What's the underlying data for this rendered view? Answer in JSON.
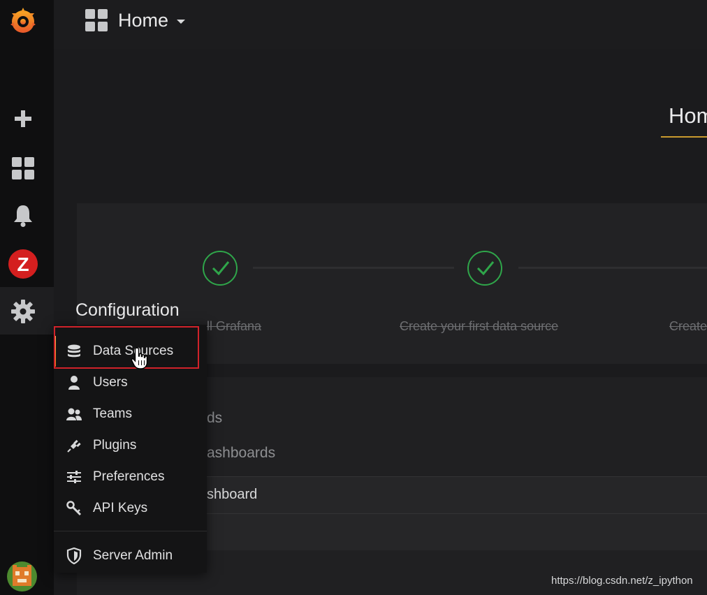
{
  "header": {
    "dashboard_title": "Home"
  },
  "sidebar": {
    "icons": [
      "grafana-logo-icon",
      "plus-icon",
      "apps-icon",
      "bell-icon",
      "zabbix-icon",
      "gear-icon",
      "avatar"
    ],
    "zabbix_letter": "Z"
  },
  "main": {
    "home_heading": "Hom",
    "steps": [
      {
        "label": "Install Grafana",
        "visible_text": "ll Grafana",
        "done": true
      },
      {
        "label": "Create your first data source",
        "visible_text": "Create your first data source",
        "done": true
      },
      {
        "label": "Create",
        "visible_text": "Create",
        "done": false
      }
    ],
    "list_fragments": [
      "ds",
      "ashboards",
      "shboard"
    ]
  },
  "config_menu": {
    "title": "Configuration",
    "items": [
      {
        "label": "Data Sources",
        "icon": "database-icon",
        "active": true
      },
      {
        "label": "Users",
        "icon": "user-icon"
      },
      {
        "label": "Teams",
        "icon": "users-icon"
      },
      {
        "label": "Plugins",
        "icon": "plug-icon"
      },
      {
        "label": "Preferences",
        "icon": "sliders-icon"
      },
      {
        "label": "API Keys",
        "icon": "key-icon"
      }
    ],
    "server_admin": {
      "label": "Server Admin",
      "icon": "shield-icon"
    }
  },
  "watermark": "https://blog.csdn.net/z_ipython",
  "colors": {
    "accent": "#eb7b18",
    "success": "#2fa64a",
    "highlight": "#d0222a",
    "underline": "#c99a2e"
  }
}
